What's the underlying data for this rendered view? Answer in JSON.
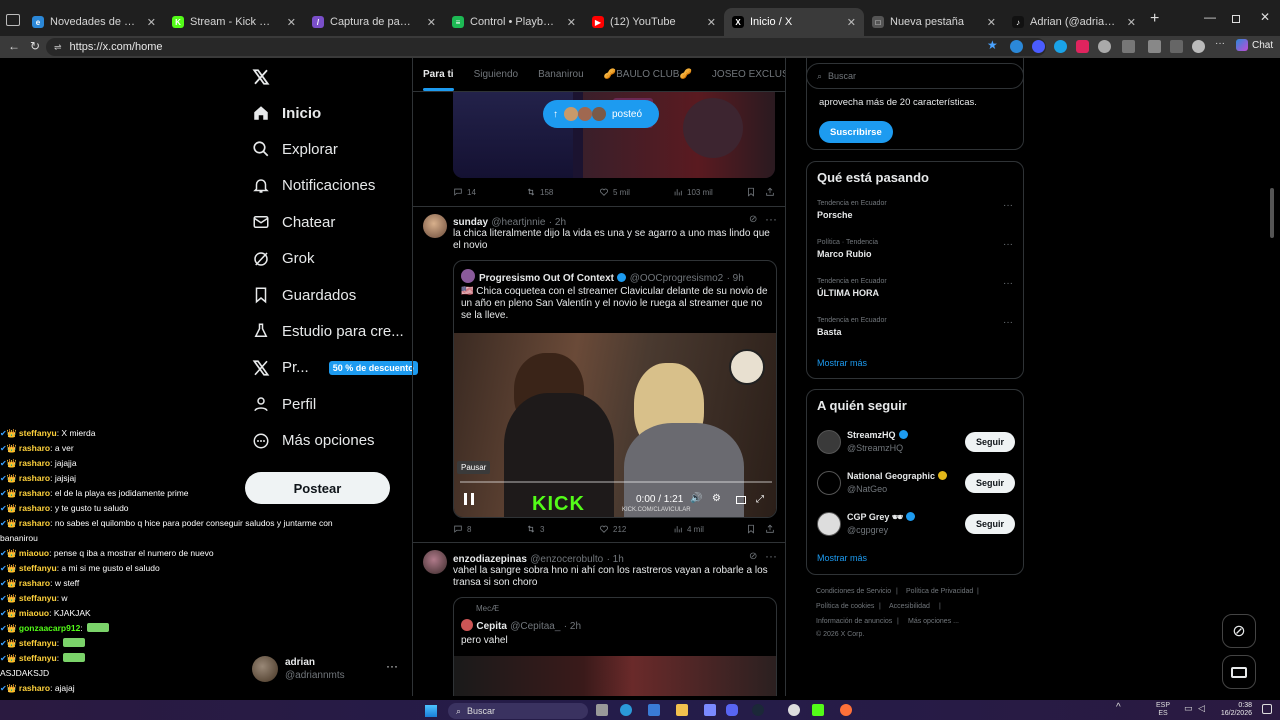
{
  "browser": {
    "tabs": [
      {
        "title": "Novedades de Microsoft Edge",
        "color": "#2b88d8",
        "glyph": "e"
      },
      {
        "title": "Stream - Kick Dashboard",
        "color": "#53fc18",
        "glyph": "K"
      },
      {
        "title": "Captura de pantalla por Lightshot",
        "color": "#7a4fc9",
        "glyph": "/"
      },
      {
        "title": "Control • Playboi Carti",
        "color": "#1db954",
        "glyph": "≡"
      },
      {
        "title": "(12) YouTube",
        "color": "#ff0000",
        "glyph": "▶"
      },
      {
        "title": "Inicio / X",
        "color": "#000000",
        "glyph": "X"
      },
      {
        "title": "Nueva pestaña",
        "color": "#555555",
        "glyph": "□"
      },
      {
        "title": "Adrian (@adrianntdg) | TikTok",
        "color": "#111111",
        "glyph": "♪"
      }
    ],
    "active_tab": 5,
    "url": "https://x.com/home",
    "chat_label": "Chat"
  },
  "nav": {
    "items": [
      {
        "label": "Inicio",
        "icon": "home-icon"
      },
      {
        "label": "Explorar",
        "icon": "search-icon"
      },
      {
        "label": "Notificaciones",
        "icon": "bell-icon"
      },
      {
        "label": "Chatear",
        "icon": "mail-icon"
      },
      {
        "label": "Grok",
        "icon": "grok-icon"
      },
      {
        "label": "Guardados",
        "icon": "bookmark-icon"
      },
      {
        "label": "Estudio para cre...",
        "icon": "flask-icon"
      },
      {
        "label": "Pr...",
        "icon": "x-logo-icon"
      },
      {
        "label": "Perfil",
        "icon": "person-icon"
      },
      {
        "label": "Más opciones",
        "icon": "more-circle-icon"
      }
    ],
    "premium_badge": "50 % de descuento",
    "post_button": "Postear",
    "account": {
      "name": "adrian",
      "handle": "@adriannmts"
    }
  },
  "chat_overlay": [
    {
      "user": "steffanyu",
      "msg": "X mierda",
      "color": "#ffd23c"
    },
    {
      "user": "rasharo",
      "msg": "a ver",
      "color": "#ffd23c"
    },
    {
      "user": "rasharo",
      "msg": "jajajja",
      "color": "#ffd23c"
    },
    {
      "user": "rasharo",
      "msg": "jajsjaj",
      "color": "#ffd23c"
    },
    {
      "user": "rasharo",
      "msg": "el de la playa es jodidamente prime",
      "color": "#ffd23c"
    },
    {
      "user": "rasharo",
      "msg": "y te gusto tu saludo",
      "color": "#ffd23c"
    },
    {
      "user": "rasharo",
      "msg": "no sabes el quilombo q hice para poder conseguir saludos y juntarme con",
      "color": "#ffd23c"
    },
    {
      "user": "",
      "msg": "bananirou",
      "color": "#ffd23c"
    },
    {
      "user": "miaouo",
      "msg": "pense q iba a mostrar el numero de nuevo",
      "color": "#ffd23c"
    },
    {
      "user": "steffanyu",
      "msg": "a mi si me gusto el saludo",
      "color": "#ffd23c"
    },
    {
      "user": "rasharo",
      "msg": "w steff",
      "color": "#ffd23c"
    },
    {
      "user": "steffanyu",
      "msg": "w",
      "color": "#ffd23c"
    },
    {
      "user": "miaouo",
      "msg": "KJAKJAK",
      "color": "#ffd23c"
    },
    {
      "user": "gonzaacarp912",
      "msg": "",
      "color": "#53fc18"
    },
    {
      "user": "steffanyu",
      "msg": "",
      "color": "#ffd23c"
    },
    {
      "user": "steffanyu",
      "msg": "",
      "color": "#ffd23c"
    },
    {
      "user": "",
      "msg": "ASJDAKSJD",
      "color": "#ff5a5a"
    },
    {
      "user": "rasharo",
      "msg": "ajajaj",
      "color": "#ffd23c"
    }
  ],
  "timeline": {
    "tabs": [
      "Para ti",
      "Siguiendo",
      "Bananirou",
      "🥜BAULO CLUB🥜",
      "JOSEO EXCLUSIVE"
    ],
    "new_posts_label": "posteó",
    "post1_actions": {
      "replies": "14",
      "reposts": "158",
      "likes": "5 mil",
      "views": "103 mil"
    },
    "post2": {
      "name": "sunday",
      "handle": "@heartjnnie",
      "time": "· 2h",
      "text": "la chica literalmente dijo la vida es una y se agarro a uno mas lindo que el novio",
      "quote": {
        "name": "Progresismo Out Of Context",
        "handle": "@OOCprogresismo2",
        "time": "· 9h",
        "text": "🇺🇸 Chica coquetea con el streamer Clavicular delante de su novio de un año en pleno San Valentín y el novio le ruega al streamer que no se la lleve."
      },
      "video": {
        "tooltip": "Pausar",
        "time": "0:00 / 1:21",
        "watermark": "KICK",
        "watermark_sub": "KICK.COM/CLAVICULAR",
        "progress": 0
      },
      "actions": {
        "replies": "8",
        "reposts": "3",
        "likes": "212",
        "views": "4 mil"
      }
    },
    "post3": {
      "name": "enzodiazepinas",
      "handle": "@enzocerobulto",
      "time": "· 1h",
      "text": "vahel la sangre sobra  hno ni ahí con los rastreros vayan a robarle a los transa si son choro",
      "quote_context": "MecÆ",
      "quote": {
        "name": "Cepita",
        "handle": "@Cepitaa_",
        "time": "· 2h",
        "text": "pero vahel"
      }
    }
  },
  "right": {
    "search_placeholder": "Buscar",
    "premium_text": "aprovecha más de 20 características.",
    "subscribe": "Suscribirse",
    "trends_title": "Qué está pasando",
    "trends": [
      {
        "context": "Tendencia en Ecuador",
        "name": "Porsche"
      },
      {
        "context": "Política · Tendencia",
        "name": "Marco Rubio"
      },
      {
        "context": "Tendencia en Ecuador",
        "name": "ÚLTIMA HORA"
      },
      {
        "context": "Tendencia en Ecuador",
        "name": "Basta"
      }
    ],
    "show_more": "Mostrar más",
    "follow_title": "A quién seguir",
    "who_to_follow": [
      {
        "name": "StreamzHQ",
        "handle": "@StreamzHQ",
        "button": "Seguir",
        "color": "#3a3a3a"
      },
      {
        "name": "National Geographic",
        "handle": "@NatGeo",
        "button": "Seguir",
        "color": "#000"
      },
      {
        "name": "CGP Grey 🕶",
        "handle": "@cgpgrey",
        "button": "Seguir",
        "color": "#ddd"
      }
    ],
    "footer": [
      "Condiciones de Servicio",
      "|",
      "Política de Privacidad",
      "|",
      "Política de cookies",
      "|",
      "Accesibilidad",
      "|",
      "Información de anuncios",
      "|",
      "Más opciones ...",
      "© 2026 X Corp."
    ]
  },
  "taskbar": {
    "search": "Buscar",
    "lang": "ESP",
    "lang_sub": "ES",
    "time": "0:38",
    "date": "16/2/2026"
  },
  "colors": {
    "accent": "#1d9bf0",
    "bg": "#000000",
    "border": "#2f3336",
    "muted": "#71767b"
  }
}
